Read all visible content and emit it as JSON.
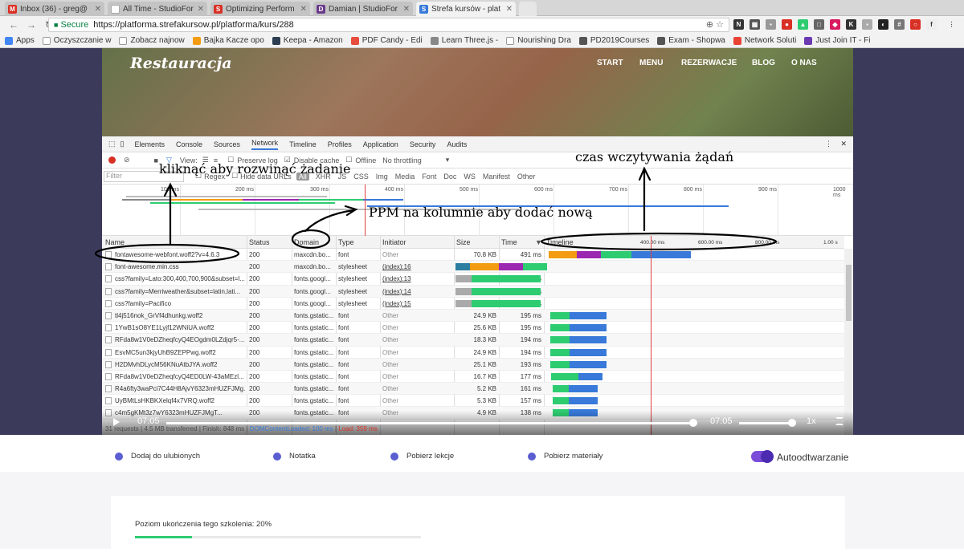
{
  "browser": {
    "tabs": [
      {
        "title": "Inbox (36) - greg@",
        "favicon": "gmail-icon",
        "color": "#d93025",
        "letter": "M",
        "active": false
      },
      {
        "title": "All Time - StudioFor",
        "favicon": "document-icon",
        "color": "#ffffff",
        "letter": "",
        "active": false
      },
      {
        "title": "Optimizing Perform",
        "favicon": "s-icon",
        "color": "#d93025",
        "letter": "S",
        "active": false
      },
      {
        "title": "Damian | StudioFor",
        "favicon": "studio-icon",
        "color": "#6a3a8a",
        "letter": "D",
        "active": false
      },
      {
        "title": "Strefa kursów - plat",
        "favicon": "strefa-icon",
        "color": "#3879d9",
        "letter": "S",
        "active": true
      }
    ],
    "secure_label": "Secure",
    "url": "https://platforma.strefakursow.pl/platforma/kurs/288",
    "bookmarks": [
      {
        "label": "Apps",
        "color": "#4285f4"
      },
      {
        "label": "Oczyszczanie w",
        "color": "#ffffff"
      },
      {
        "label": "Zobacz najnow",
        "color": "#ffffff"
      },
      {
        "label": "Bajka Kacze opo",
        "color": "#f39c12"
      },
      {
        "label": "Keepa - Amazon",
        "color": "#2c3e50"
      },
      {
        "label": "PDF Candy - Edi",
        "color": "#e74c3c"
      },
      {
        "label": "Learn Three.js -",
        "color": "#888888"
      },
      {
        "label": "Nourishing Dra",
        "color": "#ffffff"
      },
      {
        "label": "PD2019Courses",
        "color": "#555555"
      },
      {
        "label": "Exam - Shopwa",
        "color": "#555555"
      },
      {
        "label": "Network Soluti",
        "color": "#ea4335"
      },
      {
        "label": "Just Join IT - Fi",
        "color": "#6a3ab1"
      }
    ]
  },
  "hero": {
    "logo": "Restauracja",
    "nav": [
      "START",
      "MENU",
      "REZERWACJE",
      "BLOG",
      "O NAS"
    ]
  },
  "devtools": {
    "tabs": [
      "Elements",
      "Console",
      "Sources",
      "Network",
      "Timeline",
      "Profiles",
      "Application",
      "Security",
      "Audits"
    ],
    "selected_tab": "Network",
    "toolbar": {
      "view_label": "View:",
      "preserve_log": "Preserve log",
      "disable_cache": "Disable cache",
      "offline": "Offline",
      "throttling": "No throttling"
    },
    "filter": {
      "placeholder": "Filter",
      "regex": "Regex",
      "hide_data_urls": "Hide data URLs",
      "all": "All",
      "types": [
        "XHR",
        "JS",
        "CSS",
        "Img",
        "Media",
        "Font",
        "Doc",
        "WS",
        "Manifest",
        "Other"
      ]
    },
    "overview_ticks": [
      "100 ms",
      "200 ms",
      "300 ms",
      "400 ms",
      "500 ms",
      "600 ms",
      "700 ms",
      "800 ms",
      "900 ms",
      "1000 ms"
    ],
    "columns": {
      "name": "Name",
      "status": "Status",
      "domain": "Domain",
      "type": "Type",
      "initiator": "Initiator",
      "size": "Size",
      "time": "Time",
      "timeline": "Timeline"
    },
    "timeline_ticks": [
      "400.00 ms",
      "600.00 ms",
      "800.00 ms",
      "1.00 s"
    ],
    "requests": [
      {
        "name": "fontawesome-webfont.woff2?v=4.6.3",
        "status": "200",
        "domain": "maxcdn.bo...",
        "type": "font",
        "initiator": "Other",
        "link": false,
        "size": "70.8 KB",
        "time": "491 ms"
      },
      {
        "name": "font-awesome.min.css",
        "status": "200",
        "domain": "maxcdn.bo...",
        "type": "stylesheet",
        "initiator": "(index):16",
        "link": true,
        "size": "7.8 KB",
        "time": "323 ms"
      },
      {
        "name": "css?family=Lato:300,400,700,900&subset=l...",
        "status": "200",
        "domain": "fonts.googl...",
        "type": "stylesheet",
        "initiator": "(index):13",
        "link": true,
        "size": "581 B",
        "time": "291 ms"
      },
      {
        "name": "css?family=Merriweather&subset=latin,lati...",
        "status": "200",
        "domain": "fonts.googl...",
        "type": "stylesheet",
        "initiator": "(index):14",
        "link": true,
        "size": "502 B",
        "time": "290 ms"
      },
      {
        "name": "css?family=Pacifico",
        "status": "200",
        "domain": "fonts.googl...",
        "type": "stylesheet",
        "initiator": "(index):15",
        "link": true,
        "size": "643 B",
        "time": "287 ms"
      },
      {
        "name": "tl4j516nok_GrVf4dhunkg.woff2",
        "status": "200",
        "domain": "fonts.gstatic...",
        "type": "font",
        "initiator": "Other",
        "link": false,
        "size": "24.9 KB",
        "time": "195 ms"
      },
      {
        "name": "1YwB1sO8YE1Lyjf12WNiUA.woff2",
        "status": "200",
        "domain": "fonts.gstatic...",
        "type": "font",
        "initiator": "Other",
        "link": false,
        "size": "25.6 KB",
        "time": "195 ms"
      },
      {
        "name": "RFda8w1V0eDZheqfcyQ4EOgdm0LZdjqr5-...",
        "status": "200",
        "domain": "fonts.gstatic...",
        "type": "font",
        "initiator": "Other",
        "link": false,
        "size": "18.3 KB",
        "time": "194 ms"
      },
      {
        "name": "EsvMC5un3kjyUhB9ZEPPwg.woff2",
        "status": "200",
        "domain": "fonts.gstatic...",
        "type": "font",
        "initiator": "Other",
        "link": false,
        "size": "24.9 KB",
        "time": "194 ms"
      },
      {
        "name": "H2DMvhDLycM56KNuAtbJYA.woff2",
        "status": "200",
        "domain": "fonts.gstatic...",
        "type": "font",
        "initiator": "Other",
        "link": false,
        "size": "25.1 KB",
        "time": "193 ms"
      },
      {
        "name": "RFda8w1V0eDZheqfcyQ4ED0LW-43aMEzl...",
        "status": "200",
        "domain": "fonts.gstatic...",
        "type": "font",
        "initiator": "Other",
        "link": false,
        "size": "16.7 KB",
        "time": "177 ms"
      },
      {
        "name": "R4a6fty3waPci7C44H8AjvY6323mHUZFJMg...",
        "status": "200",
        "domain": "fonts.gstatic...",
        "type": "font",
        "initiator": "Other",
        "link": false,
        "size": "5.2 KB",
        "time": "161 ms"
      },
      {
        "name": "UyBMtLsHKBKXelqf4x7VRQ.woff2",
        "status": "200",
        "domain": "fonts.gstatic...",
        "type": "font",
        "initiator": "Other",
        "link": false,
        "size": "5.3 KB",
        "time": "157 ms"
      },
      {
        "name": "c4m5gKMt3z7wY6323mHUZFJMgT...",
        "status": "200",
        "domain": "fonts.gstatic...",
        "type": "font",
        "initiator": "Other",
        "link": false,
        "size": "4.9 KB",
        "time": "138 ms"
      }
    ],
    "status_bar": {
      "requests": "31 requests",
      "transferred": "4.5 MB transferred",
      "finish": "Finish: 848 ms",
      "dcl": "DOMContentLoaded: 100 ms",
      "load": "Load: 359 ms"
    }
  },
  "player": {
    "current_time": "07:05",
    "duration": "07:05",
    "progress": 1.0,
    "volume": 1.0,
    "speed": "1x"
  },
  "actions": [
    {
      "label": "Dodaj do ulubionych",
      "icon": "heart-icon"
    },
    {
      "label": "Notatka",
      "icon": "pencil-icon"
    },
    {
      "label": "Pobierz lekcje",
      "icon": "cloud-download-icon"
    },
    {
      "label": "Pobierz materiały",
      "icon": "folder-icon"
    }
  ],
  "autoplay": {
    "label": "Autoodtwarzanie",
    "on": true
  },
  "progress": {
    "label": "Poziom ukończenia tego szkolenia: 20%",
    "value": 0.2
  },
  "annotations": {
    "expand_request": "kliknąć aby rozwinąć żadanie",
    "load_time": "czas wczytywania żądań",
    "add_column": "PPM na kolumnie aby dodać nową"
  },
  "colors": {
    "accent": "#3879d9",
    "player_dark": "#3b3a5b",
    "progress_green": "#2ecc71",
    "toggle": "#7c4dd8"
  }
}
